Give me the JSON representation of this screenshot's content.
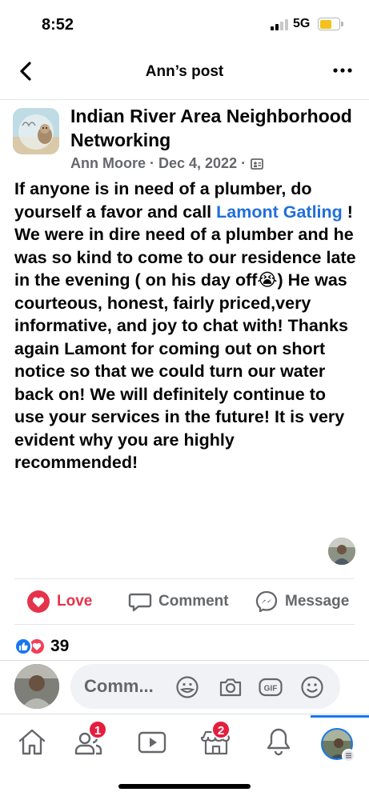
{
  "status_bar": {
    "time": "8:52",
    "network": "5G"
  },
  "header": {
    "title": "Ann’s post"
  },
  "post": {
    "group_name": "Indian River Area Neighborhood Networking",
    "author": "Ann Moore",
    "date": "Dec 4, 2022",
    "separator": "·",
    "body_before_mention": "If anyone is in need of a plumber, do yourself a favor and call ",
    "mention": "Lamont Gatling",
    "body_after_mention": " ! We were in dire need of a plumber and he was so kind to come to our residence late in the evening ( on his day off😭) He was courteous, honest, fairly priced,very informative, and joy to chat with! Thanks again Lamont for coming out on short notice so that we could turn our water back on! We will definitely continue to use your services in the future! It is very evident why you are highly recommended!"
  },
  "actions": {
    "love": "Love",
    "comment": "Comment",
    "message": "Message"
  },
  "reactions": {
    "count": "39"
  },
  "composer": {
    "placeholder": "Comm..."
  },
  "tabs": {
    "friends_badge": "1",
    "marketplace_badge": "2"
  },
  "colors": {
    "accent": "#1877f2",
    "love": "#e4334a",
    "mention": "#216fdb",
    "badge": "#e41e3f"
  },
  "icons": [
    "back-arrow-icon",
    "more-icon",
    "audience-icon",
    "love-heart-icon",
    "comment-icon",
    "messenger-icon",
    "like-reaction-icon",
    "love-reaction-icon",
    "sticker-icon",
    "camera-icon",
    "gif-icon",
    "emoji-icon",
    "home-icon",
    "friends-icon",
    "video-icon",
    "marketplace-icon",
    "bell-icon",
    "menu-icon"
  ]
}
